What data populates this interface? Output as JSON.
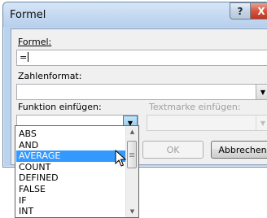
{
  "window": {
    "title": "Formel",
    "help_label": "?",
    "close_label": "X"
  },
  "formula": {
    "label": "Formel:",
    "value": "="
  },
  "number_format": {
    "label": "Zahlenformat:",
    "value": ""
  },
  "insert_function": {
    "label": "Funktion einfügen:",
    "value": ""
  },
  "insert_bookmark": {
    "label": "Textmarke einfügen:",
    "value": ""
  },
  "buttons": {
    "ok_label": "OK",
    "cancel_label": "Abbrechen"
  },
  "function_list": {
    "items": [
      "ABS",
      "AND",
      "AVERAGE",
      "COUNT",
      "DEFINED",
      "FALSE",
      "IF",
      "INT"
    ],
    "selected": "AVERAGE"
  },
  "icons": {
    "dropdown_arrow": "chevron-down-icon",
    "mouse_cursor": "arrow-cursor-icon"
  },
  "colors": {
    "selection": "#3399ff",
    "close_button": "#c0341c",
    "title_bar": "#c3d8f0"
  }
}
